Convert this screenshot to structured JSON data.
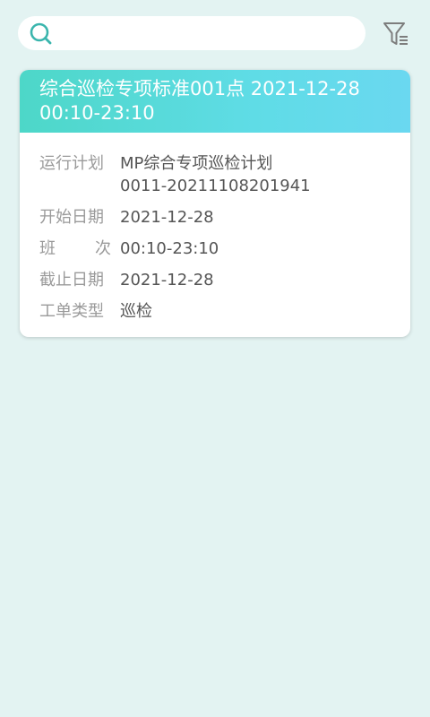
{
  "search": {
    "value": "",
    "placeholder": ""
  },
  "card": {
    "title_line1": "综合巡检专项标准001点 2021-12-28",
    "title_line2": "00:10-23:10",
    "rows": [
      {
        "label": "运行计划",
        "value_line1": "MP综合专项巡检计划",
        "value_line2": "0011-20211108201941"
      },
      {
        "label": "开始日期",
        "value": "2021-12-28"
      },
      {
        "label_part1": "班",
        "label_part2": "次",
        "value": "00:10-23:10"
      },
      {
        "label": "截止日期",
        "value": "2021-12-28"
      },
      {
        "label": "工单类型",
        "value": "巡检"
      }
    ]
  },
  "colors": {
    "background": "#e3f3f2",
    "accent": "#4fc2b8",
    "header_gradient_start": "#4dd7c8",
    "header_gradient_end": "#6ad8f0"
  },
  "icons": {
    "search": "search-icon",
    "filter": "filter-icon"
  }
}
